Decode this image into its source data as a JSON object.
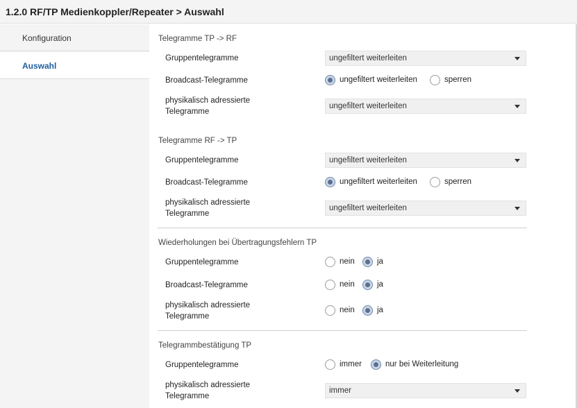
{
  "header": {
    "title": "1.2.0 RF/TP Medienkoppler/Repeater > Auswahl"
  },
  "sidebar": {
    "items": [
      {
        "label": "Konfiguration",
        "active": false
      },
      {
        "label": "Auswahl",
        "active": true
      }
    ]
  },
  "sections": {
    "tp_rf": {
      "title": "Telegramme TP -> RF",
      "gruppen": {
        "label": "Gruppentelegramme",
        "value": "ungefiltert weiterleiten"
      },
      "broadcast": {
        "label": "Broadcast-Telegramme",
        "option1": "ungefiltert weiterleiten",
        "option2": "sperren",
        "selected": "ungefiltert weiterleiten"
      },
      "physical": {
        "label_line1": "physikalisch adressierte",
        "label_line2": "Telegramme",
        "value": "ungefiltert weiterleiten"
      }
    },
    "rf_tp": {
      "title": "Telegramme RF -> TP",
      "gruppen": {
        "label": "Gruppentelegramme",
        "value": "ungefiltert weiterleiten"
      },
      "broadcast": {
        "label": "Broadcast-Telegramme",
        "option1": "ungefiltert weiterleiten",
        "option2": "sperren",
        "selected": "ungefiltert weiterleiten"
      },
      "physical": {
        "label_line1": "physikalisch adressierte",
        "label_line2": "Telegramme",
        "value": "ungefiltert weiterleiten"
      }
    },
    "wiederholungen": {
      "title": "Wiederholungen bei Übertragungsfehlern TP",
      "gruppen": {
        "label": "Gruppentelegramme",
        "option1": "nein",
        "option2": "ja",
        "selected": "ja"
      },
      "broadcast": {
        "label": "Broadcast-Telegramme",
        "option1": "nein",
        "option2": "ja",
        "selected": "ja"
      },
      "physical": {
        "label_line1": "physikalisch adressierte",
        "label_line2": "Telegramme",
        "option1": "nein",
        "option2": "ja",
        "selected": "ja"
      }
    },
    "bestaetigung": {
      "title": "Telegrammbestätigung TP",
      "gruppen": {
        "label": "Gruppentelegramme",
        "option1": "immer",
        "option2": "nur bei Weiterleitung",
        "selected": "nur bei Weiterleitung"
      },
      "physical": {
        "label_line1": "physikalisch adressierte",
        "label_line2": "Telegramme",
        "value": "immer"
      }
    }
  },
  "icons": {
    "dropdown": "chevron-down-icon",
    "radio": "radio-button-icon"
  },
  "colors": {
    "accent": "#1f5f9e",
    "radio_checked": "#5c6f8c"
  }
}
